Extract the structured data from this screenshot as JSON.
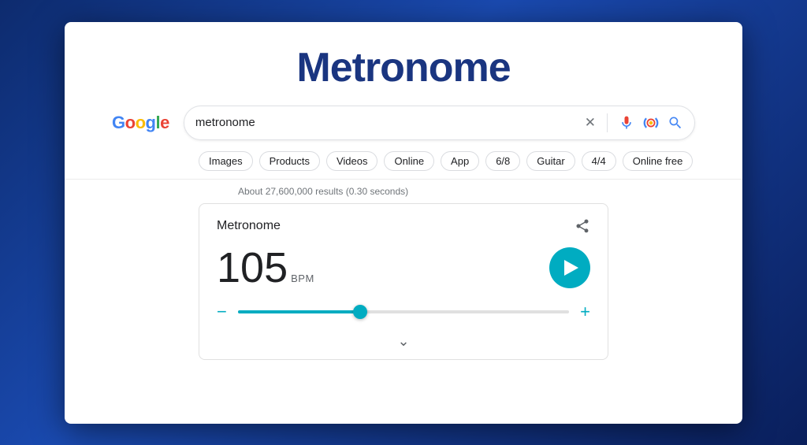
{
  "background": {
    "color": "#1a3a8c"
  },
  "page_title": "Metronome",
  "google_logo": {
    "text": "Google",
    "letters": [
      "G",
      "o",
      "o",
      "g",
      "l",
      "e"
    ]
  },
  "search_bar": {
    "query": "metronome",
    "placeholder": "Search",
    "clear_label": "×",
    "mic_label": "Voice Search",
    "lens_label": "Search by Image",
    "search_label": "Search"
  },
  "filter_chips": [
    {
      "label": "Images"
    },
    {
      "label": "Products"
    },
    {
      "label": "Videos"
    },
    {
      "label": "Online"
    },
    {
      "label": "App"
    },
    {
      "label": "6/8"
    },
    {
      "label": "Guitar"
    },
    {
      "label": "4/4"
    },
    {
      "label": "Online free"
    }
  ],
  "results_count": "About 27,600,000 results (0.30 seconds)",
  "widget": {
    "title": "Metronome",
    "share_label": "Share",
    "bpm_value": "105",
    "bpm_unit": "BPM",
    "play_label": "Play",
    "minus_label": "Decrease BPM",
    "plus_label": "Increase BPM",
    "slider_percent": 37,
    "expand_label": "Show more"
  }
}
